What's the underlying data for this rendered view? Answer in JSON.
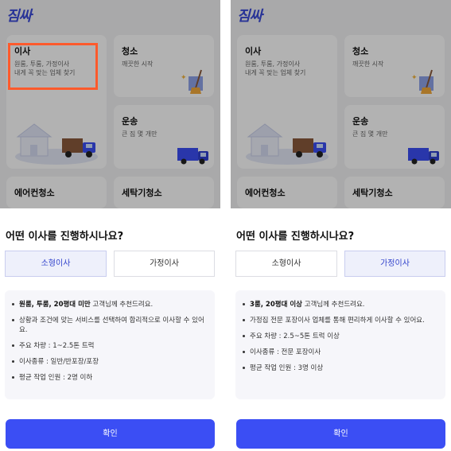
{
  "app": {
    "logo": "짐싸"
  },
  "cards": {
    "move": {
      "title": "이사",
      "sub1": "원룸, 투룸, 가정이사",
      "sub2": "내게 꼭 맞는 업체 찾기"
    },
    "clean": {
      "title": "청소",
      "sub": "깨끗한 시작"
    },
    "truck": {
      "title": "운송",
      "sub": "큰 짐 몇 개만"
    },
    "ac": {
      "title": "에어컨청소"
    },
    "wash": {
      "title": "세탁기청소"
    }
  },
  "sheet": {
    "question": "어떤 이사를 진행하시나요?",
    "options": [
      "소형이사",
      "가정이사"
    ],
    "confirm": "확인"
  },
  "left_panel": {
    "selected": "소형이사",
    "info": {
      "line1_bold": "원룸, 투룸, 20평대 미만",
      "line1_rest": " 고객님께 추천드려요.",
      "line2": "상황과 조건에 맞는 서비스를 선택하여 합리적으로 이사할 수 있어요.",
      "line3": "주요 차량 : 1~2.5톤 트럭",
      "line4": "이사종류 : 일반/반포장/포장",
      "line5": "평균 작업 인원 : 2명 이하"
    }
  },
  "right_panel": {
    "selected": "가정이사",
    "info": {
      "line1_bold": "3룸, 20평대 이상",
      "line1_rest": " 고객님께 추천드려요.",
      "line2": "가정집 전문 포장이사 업체를 통해 편리하게 이사할 수 있어요.",
      "line3": "주요 차량 : 2.5~5톤 트럭 이상",
      "line4": "이사종류 : 전문 포장이사",
      "line5": "평균 작업 인원 : 3명 이상"
    }
  },
  "colors": {
    "brand": "#3a4ad8",
    "button": "#3b4ef4",
    "highlight": "#ff5a2c",
    "selected_bg": "#eef0fb"
  },
  "icons": [
    "house-truck-illustration",
    "broom-sparkle-illustration",
    "blue-truck-illustration"
  ]
}
